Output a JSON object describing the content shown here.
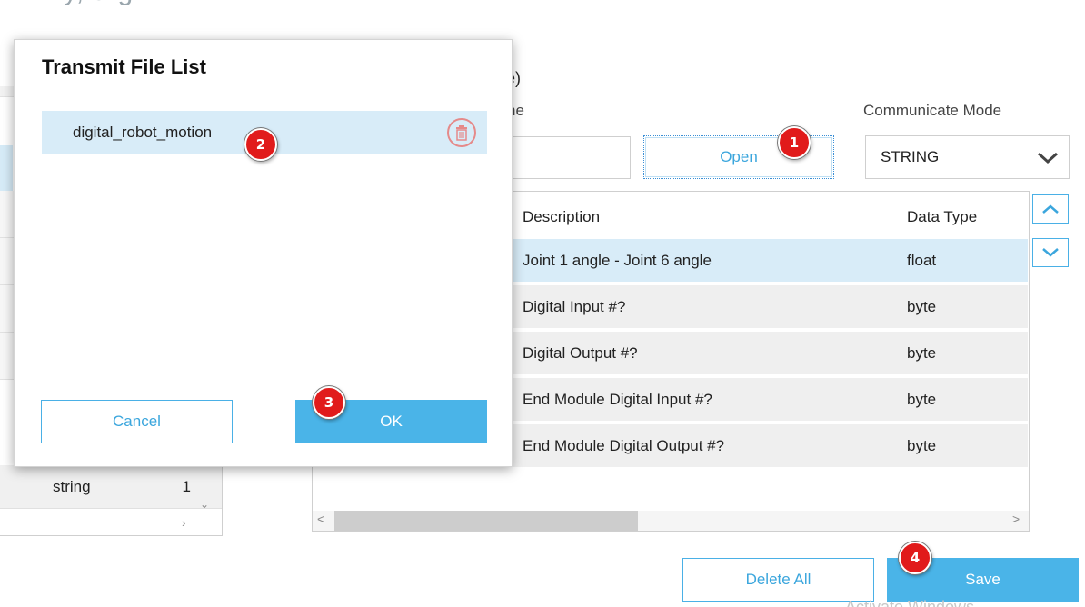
{
  "header": {
    "title_partial": "y, a            g"
  },
  "left_panel": {
    "row": {
      "type": "string",
      "value": "1"
    }
  },
  "config": {
    "partial_section_label": "le)",
    "partial_name_label": "ne",
    "open_button_label": "Open",
    "communicate_mode_label": "Communicate Mode",
    "communicate_mode_value": "STRING",
    "name_input_value": ""
  },
  "table": {
    "headers": {
      "description": "Description",
      "data_type": "Data Type"
    },
    "rows": [
      {
        "description": "Joint 1 angle - Joint 6 angle",
        "data_type": "float"
      },
      {
        "description": "Digital Input #?",
        "data_type": "byte"
      },
      {
        "description": "Digital Output #?",
        "data_type": "byte"
      },
      {
        "description": "End Module Digital Input #?",
        "data_type": "byte"
      },
      {
        "description": "End Module Digital Output #?",
        "data_type": "byte"
      }
    ]
  },
  "footer": {
    "delete_all_label": "Delete All",
    "save_label": "Save",
    "watermark": "Activate Windows"
  },
  "modal": {
    "title": "Transmit File List",
    "file_item": "digital_robot_motion",
    "cancel_label": "Cancel",
    "ok_label": "OK"
  },
  "badges": [
    "1",
    "2",
    "3",
    "4"
  ],
  "colors": {
    "accent": "#4ab4e8",
    "accent_text": "#3ba6dd",
    "selection": "#d8ecf8",
    "badge": "#e11b1b"
  },
  "icons": [
    "trash-icon",
    "chevron-down-icon",
    "scroll-up-icon",
    "scroll-down-icon"
  ]
}
